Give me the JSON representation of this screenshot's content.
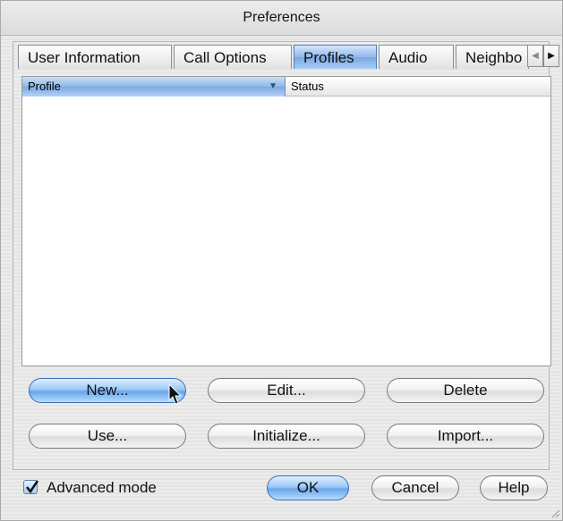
{
  "window": {
    "title": "Preferences"
  },
  "tabs": [
    {
      "label": "User Information",
      "active": false
    },
    {
      "label": "Call Options",
      "active": false
    },
    {
      "label": "Profiles",
      "active": true
    },
    {
      "label": "Audio",
      "active": false
    },
    {
      "label": "Neighbo",
      "active": false
    }
  ],
  "list": {
    "columns": [
      "Profile",
      "Status"
    ],
    "sorted_column": "Profile",
    "rows": []
  },
  "buttons": {
    "new": "New...",
    "edit": "Edit...",
    "delete": "Delete",
    "use": "Use...",
    "initialize": "Initialize...",
    "import": "Import...",
    "ok": "OK",
    "cancel": "Cancel",
    "help": "Help"
  },
  "advanced_mode": {
    "label": "Advanced mode",
    "checked": true
  },
  "colors": {
    "accent": "#7aa7e2",
    "default_button": "#6aa6ec"
  }
}
